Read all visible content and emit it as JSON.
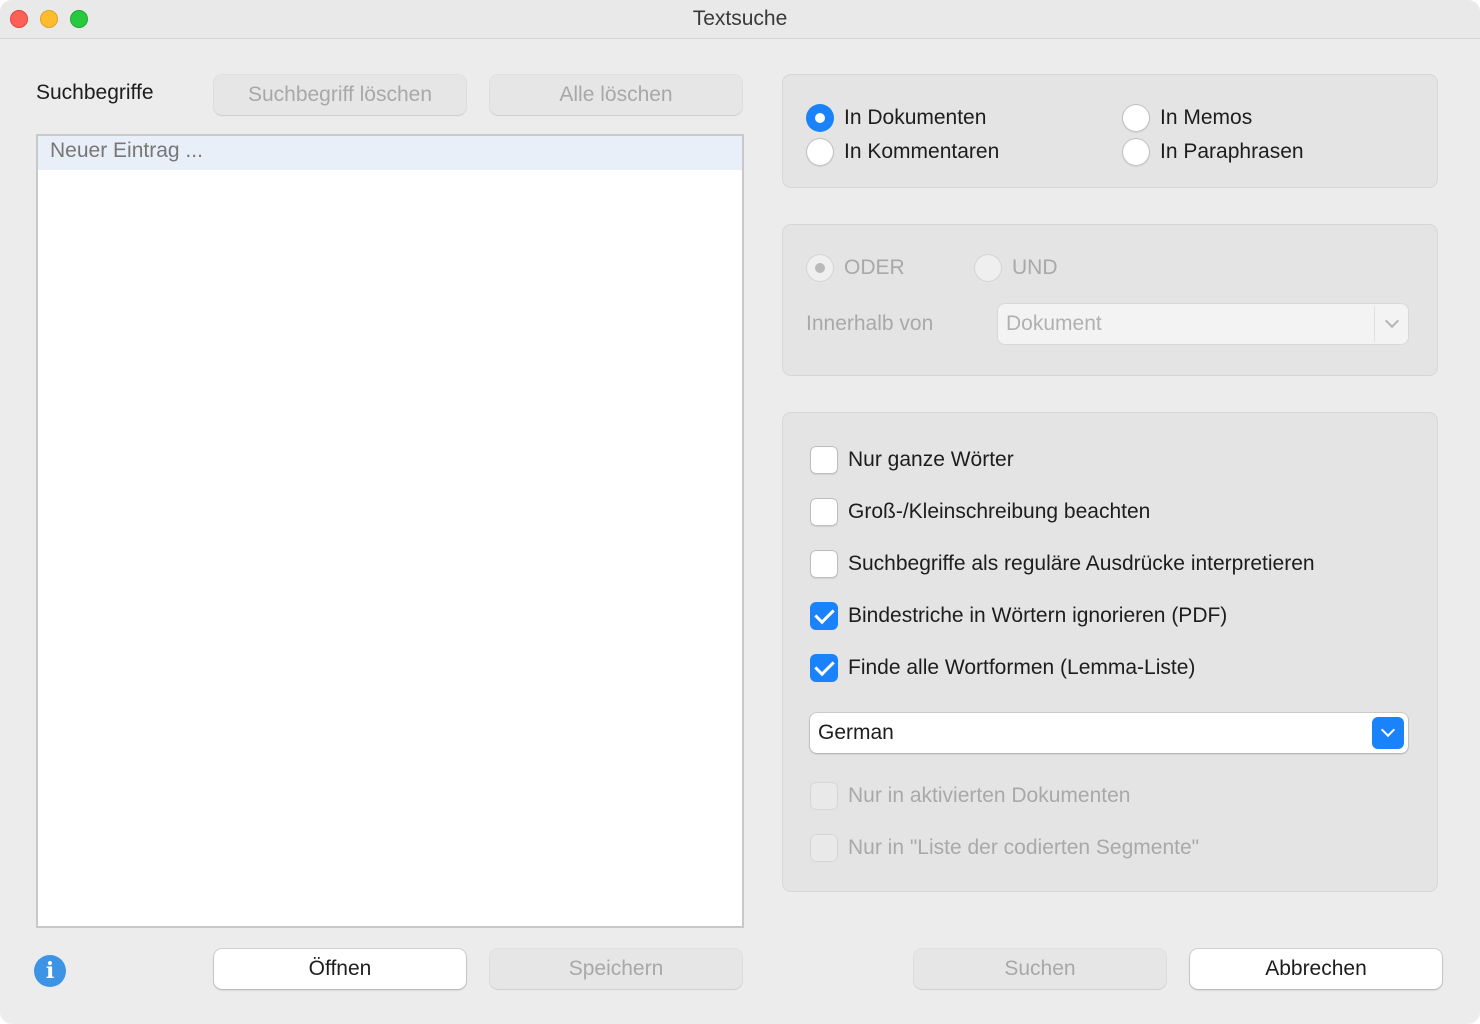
{
  "window": {
    "title": "Textsuche"
  },
  "search_terms": {
    "label": "Suchbegriffe",
    "delete_term_label": "Suchbegriff löschen",
    "delete_all_label": "Alle löschen",
    "new_entry_placeholder": "Neuer Eintrag ..."
  },
  "scope": {
    "options": [
      {
        "label": "In Dokumenten",
        "selected": true
      },
      {
        "label": "In Memos",
        "selected": false
      },
      {
        "label": "In Kommentaren",
        "selected": false
      },
      {
        "label": "In Paraphrasen",
        "selected": false
      }
    ]
  },
  "logic": {
    "or_label": "ODER",
    "and_label": "UND",
    "or_selected": true,
    "within_label": "Innerhalb von",
    "within_value": "Dokument",
    "enabled": false
  },
  "options": {
    "whole_words": {
      "label": "Nur ganze Wörter",
      "checked": false
    },
    "case_sensitive": {
      "label": "Groß-/Kleinschreibung beachten",
      "checked": false
    },
    "regex": {
      "label": "Suchbegriffe als reguläre Ausdrücke interpretieren",
      "checked": false
    },
    "ignore_hyphens": {
      "label": "Bindestriche in Wörtern ignorieren (PDF)",
      "checked": true
    },
    "all_word_forms": {
      "label": "Finde alle Wortformen (Lemma-Liste)",
      "checked": true
    },
    "language": "German",
    "only_activated": {
      "label": "Nur in aktivierten Dokumenten",
      "checked": false,
      "enabled": false
    },
    "only_coded_segments": {
      "label": "Nur in \"Liste der codierten Segmente\"",
      "checked": false,
      "enabled": false
    }
  },
  "footer": {
    "open_label": "Öffnen",
    "save_label": "Speichern",
    "search_label": "Suchen",
    "cancel_label": "Abbrechen",
    "info_icon": "info-icon"
  },
  "colors": {
    "accent": "#1a82fb",
    "window_bg": "#ececec"
  }
}
